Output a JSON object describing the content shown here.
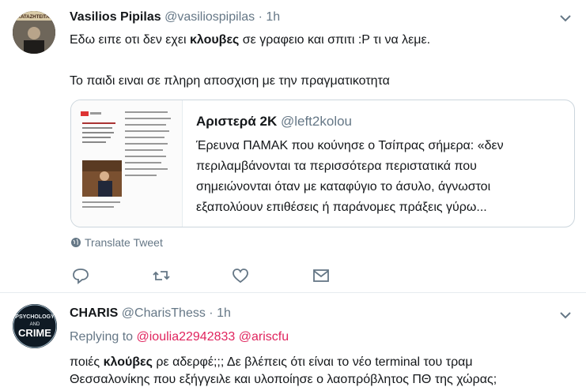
{
  "tweet1": {
    "name": "Vasilios Pipilas",
    "handle": "@vasiliospipilas",
    "dot": "·",
    "time": "1h",
    "avatar_text": "ΚΑΤΑΖΗΤΕΙΤΑΙ",
    "line1_pre": "Εδω ειπε οτι δεν εχει ",
    "line1_bold": "κλουβες",
    "line1_post": " σε γραφειο και σπιτι :P τι να λεμε.",
    "line2": "Το παιδι ειναι σε πληρη αποσχιση με την πραγματικοτητα",
    "quote": {
      "name": "Αριστερά 2Κ",
      "handle": "@left2kolou",
      "lines": [
        "Έρευνα ΠΑΜΑΚ που κούνησε ο Τσίπρας σήμερα: «δεν",
        "περιλαμβάνονται τα περισσότερα περιστατικά που",
        "σημειώνονται όταν με καταφύγιο το άσυλο, άγνωστοι",
        "εξαπολύουν επιθέσεις ή παράνομες πράξεις γύρω..."
      ]
    },
    "translate": "Translate Tweet",
    "actions": [
      "reply-icon",
      "retweet-icon",
      "like-icon",
      "message-icon"
    ]
  },
  "tweet2": {
    "name": "CHARIS",
    "handle": "@CharisThess",
    "dot": "·",
    "time": "1h",
    "avatar_text": [
      "PSYCHOLOGY",
      "AND",
      "CRIME"
    ],
    "replying_label": "Replying to",
    "mention1": "@ioulia22942833",
    "mention2": "@ariscfu",
    "line1_pre": "ποιές ",
    "line1_bold": "κλούβες",
    "line1_post": " ρε αδερφέ;;; Δε βλέπεις ότι είναι το νέο terminal του τραμ",
    "line2": "Θεσσαλονίκης που εξήγγειλε και υλοποίησε ο λαοπρόβλητος ΠΘ της χώρας;"
  },
  "colors": {
    "accent_mention": "#e0245e",
    "muted": "#657786",
    "border": "#e6ecf0"
  }
}
